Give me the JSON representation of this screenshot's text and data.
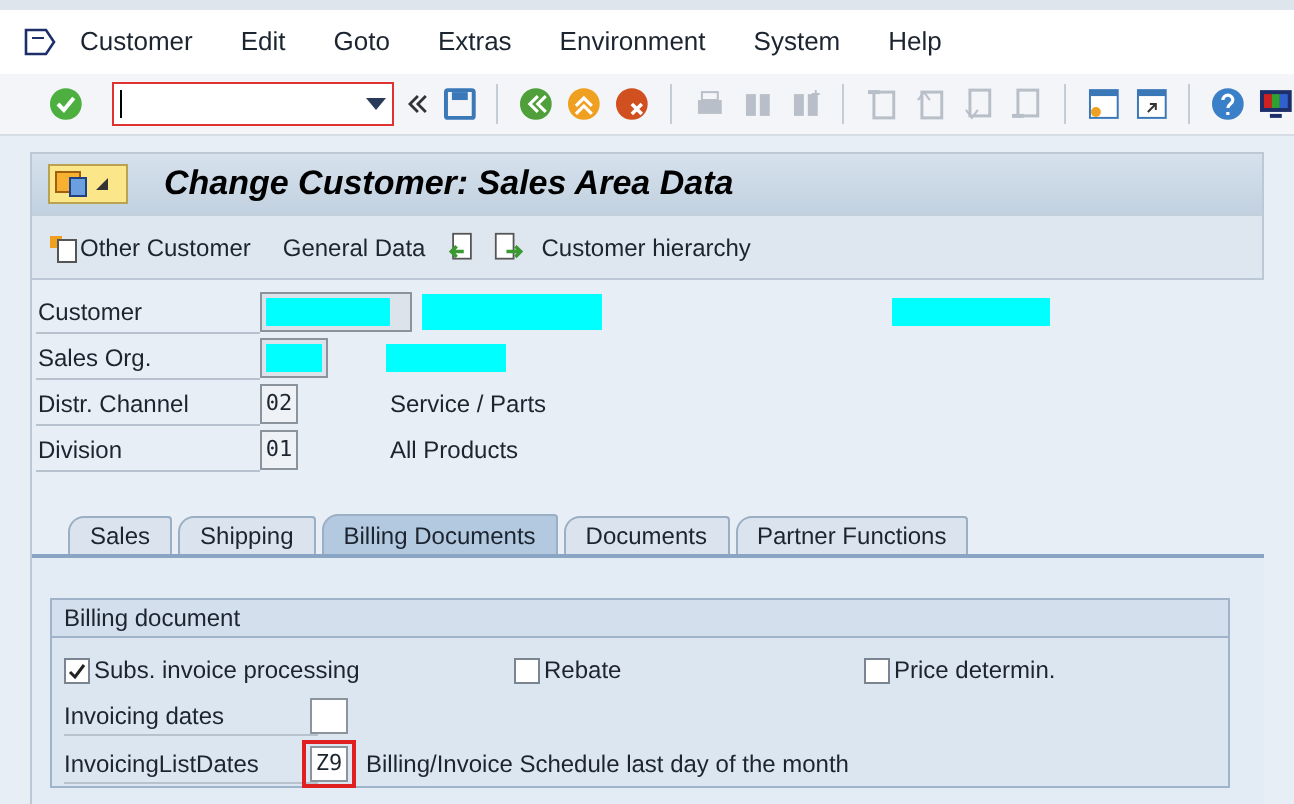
{
  "menu": [
    {
      "label": "Customer"
    },
    {
      "label": "Edit"
    },
    {
      "label": "Goto"
    },
    {
      "label": "Extras"
    },
    {
      "label": "Environment"
    },
    {
      "label": "System"
    },
    {
      "label": "Help"
    }
  ],
  "title": "Change Customer: Sales Area Data",
  "app_toolbar": [
    {
      "kind": "other",
      "label": "Other Customer"
    },
    {
      "kind": "text",
      "label": "General Data"
    },
    {
      "kind": "prev"
    },
    {
      "kind": "next"
    },
    {
      "kind": "text",
      "label": "Customer hierarchy"
    }
  ],
  "header_fields": [
    {
      "kind": "redacted_long",
      "label": "Customer"
    },
    {
      "kind": "redacted_short",
      "label": "Sales Org."
    },
    {
      "kind": "coded",
      "label": "Distr. Channel",
      "value": "02",
      "description": "Service / Parts"
    },
    {
      "kind": "coded",
      "label": "Division",
      "value": "01",
      "description": "All Products"
    }
  ],
  "tabs": [
    {
      "label": "Sales",
      "selected": false
    },
    {
      "label": "Shipping",
      "selected": false
    },
    {
      "label": "Billing Documents",
      "selected": true
    },
    {
      "label": "Documents",
      "selected": false
    },
    {
      "label": "Partner Functions",
      "selected": false
    }
  ],
  "group": {
    "title": "Billing document",
    "checkboxes": [
      {
        "label": "Subs. invoice processing",
        "checked": true
      },
      {
        "label": "Rebate",
        "checked": false
      },
      {
        "label": "Price determin.",
        "checked": false
      }
    ],
    "fields": [
      {
        "label": "Invoicing dates",
        "highlighted": false
      },
      {
        "label": "InvoicingListDates",
        "value": "Z9",
        "highlighted": true,
        "description": "Billing/Invoice Schedule last day of the month"
      }
    ]
  }
}
